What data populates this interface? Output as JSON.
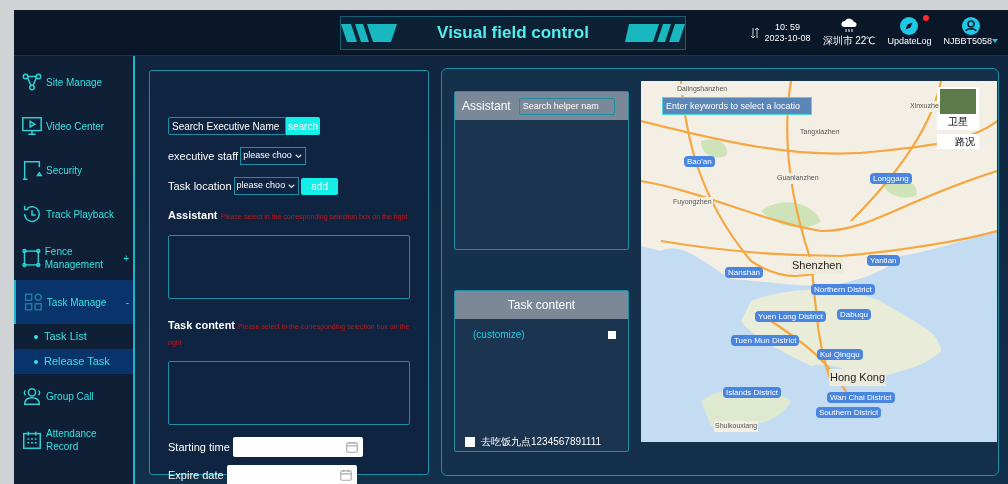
{
  "header": {
    "title": "Visual field control",
    "time": "10: 59",
    "date": "2023-10-08",
    "weather": "深圳市 22℃",
    "update_log": {
      "label": "UpdateLog",
      "unread": true
    },
    "user": "NJBBT5058"
  },
  "sidebar": {
    "items": [
      {
        "label": "Site Manage",
        "selected": false
      },
      {
        "label": "Video Center",
        "selected": false
      },
      {
        "label": "Security",
        "selected": false
      },
      {
        "label": "Track Playback",
        "selected": false
      },
      {
        "label": "Fence Management",
        "selected": false,
        "toggle": "+"
      },
      {
        "label": "Task Manage",
        "selected": true,
        "toggle": "-",
        "children": [
          {
            "label": "Task List",
            "selected": false
          },
          {
            "label": "Release Task",
            "selected": true
          }
        ]
      },
      {
        "label": "Group Call",
        "selected": false
      },
      {
        "label": "Attendance Record",
        "selected": false
      }
    ]
  },
  "form": {
    "search": {
      "placeholder": "Search Executive Name",
      "button": "search"
    },
    "executive_staff": {
      "label": "executive staff",
      "value": "please choo"
    },
    "task_location": {
      "label": "Task location",
      "value": "please choo",
      "button": "add"
    },
    "assistant": {
      "label": "Assistant",
      "hint": "Please select in the corresponding selection box on the right"
    },
    "task_content": {
      "label": "Task content",
      "hint": "Please select in the corresponding selection box on the right"
    },
    "starting_time": {
      "label": "Starting time"
    },
    "expire_date": {
      "label": "Expire date"
    }
  },
  "assistant_panel": {
    "title": "Assistant",
    "search_placeholder": "Search helper nam"
  },
  "task_content_panel": {
    "title": "Task content",
    "items": [
      {
        "label": "(customize)",
        "checked": false,
        "kind": "custom"
      },
      {
        "label": "去吃饭九点1234567891111",
        "checked": false,
        "kind": "task"
      }
    ]
  },
  "map": {
    "search_placeholder": "Enter keywords to select a locatio",
    "layers": [
      {
        "label": "卫星",
        "kind": "thumb"
      },
      {
        "label": "路况",
        "kind": "plain"
      }
    ],
    "labels": [
      {
        "text": "Dalingshanzhen",
        "kind": "place"
      },
      {
        "text": "Tangxiazhen",
        "kind": "place"
      },
      {
        "text": "Xinxuzhe",
        "kind": "place"
      },
      {
        "text": "Bao'an",
        "kind": "district"
      },
      {
        "text": "Guanlanzhen",
        "kind": "place"
      },
      {
        "text": "Longgang",
        "kind": "district"
      },
      {
        "text": "Fuyongzhen",
        "kind": "place"
      },
      {
        "text": "Shenzhen",
        "kind": "city"
      },
      {
        "text": "Nanshan",
        "kind": "district"
      },
      {
        "text": "Yantian",
        "kind": "district"
      },
      {
        "text": "Northern District",
        "kind": "district"
      },
      {
        "text": "Yuen Long District",
        "kind": "district"
      },
      {
        "text": "Dabuqu",
        "kind": "district"
      },
      {
        "text": "Tuen Mun District",
        "kind": "district"
      },
      {
        "text": "Kui Qingqu",
        "kind": "district"
      },
      {
        "text": "Hong Kong",
        "kind": "city"
      },
      {
        "text": "Islands District",
        "kind": "district"
      },
      {
        "text": "Wan Chai District",
        "kind": "district"
      },
      {
        "text": "Southern District",
        "kind": "district"
      },
      {
        "text": "Shuikouxiang",
        "kind": "place"
      }
    ]
  }
}
